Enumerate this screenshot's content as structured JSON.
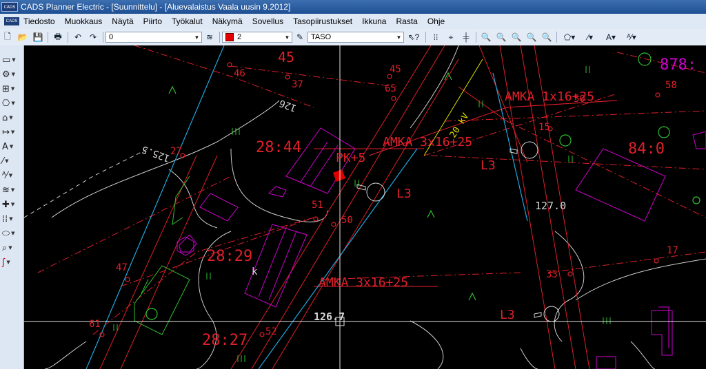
{
  "window": {
    "title": "CADS Planner Electric - [Suunnittelu] - [Aluevalaistus Vaala uusin 9.2012]",
    "logo_text": "CADS"
  },
  "menu": {
    "items": [
      {
        "label": "Tiedosto"
      },
      {
        "label": "Muokkaus"
      },
      {
        "label": "Näytä"
      },
      {
        "label": "Piirto"
      },
      {
        "label": "Työkalut"
      },
      {
        "label": "Näkymä"
      },
      {
        "label": "Sovellus"
      },
      {
        "label": "Tasopiirustukset"
      },
      {
        "label": "Ikkuna"
      },
      {
        "label": "Rasta"
      },
      {
        "label": "Ohje"
      }
    ]
  },
  "toolbar": {
    "layer_value": "0",
    "color_value": "2",
    "color_swatch": "#e00000",
    "taso_value": "TASO"
  },
  "drawing": {
    "labels": {
      "l45a": "45",
      "l45b": "45",
      "l46": "46",
      "l37": "37",
      "l65": "65",
      "l126": "126",
      "l125_5": "125.5",
      "l27": "27",
      "l28_44": "28:44",
      "pk5": "PK+5",
      "amka1": "AMKA 3x16+25",
      "amka2": "AMKA 1x16+25",
      "amka3": "AMKA 3x16+25",
      "l20kv": "20 kV",
      "l3a": "L3",
      "l3b": "L3",
      "l3c": "L3",
      "l51": "51",
      "l50a": "50",
      "l50b": "50",
      "l28_29": "28:29",
      "lk": "k",
      "l47": "47",
      "l127": "127.0",
      "l84": "84:0",
      "l878": "878:",
      "l58": "58",
      "l15": "15",
      "l17": "17",
      "l33": "33",
      "l126_7": "126.7",
      "l28_27": "28:27",
      "l52": "52",
      "l61": "61"
    }
  },
  "colors": {
    "red": "#e0202a",
    "magenta": "#d000d0",
    "green": "#30c030",
    "cyan": "#20a8e0",
    "white": "#d8d8d8",
    "yellow": "#e0e000"
  }
}
